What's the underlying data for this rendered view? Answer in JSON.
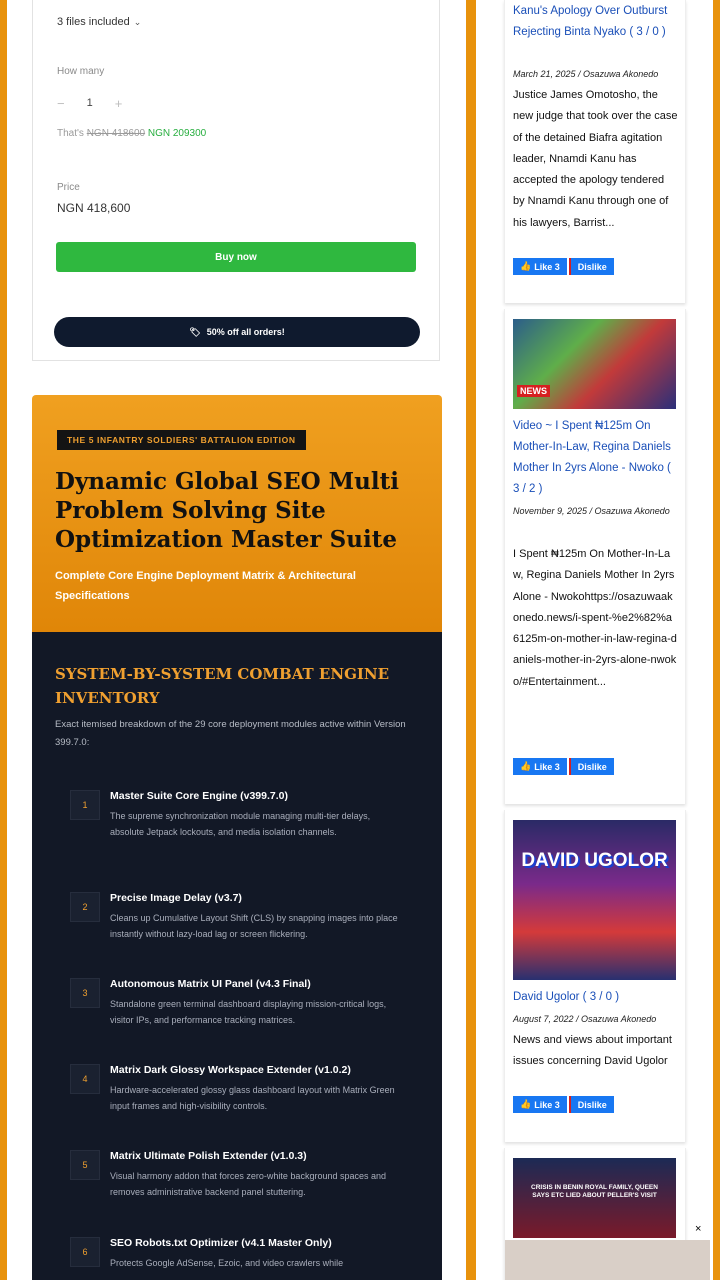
{
  "product_card": {
    "files_included": "3 files included",
    "how_many_label": "How many",
    "quantity": "1",
    "minus": "−",
    "plus": "+",
    "thats_prefix": "That's",
    "old_price": "NGN 418600",
    "new_price": "NGN 209300",
    "price_label": "Price",
    "price_value": "NGN 418,600",
    "buy_label": "Buy now",
    "promo_label": "50% off all orders!"
  },
  "hero": {
    "badge": "THE 5 INFANTRY SOLDIERS' BATTALION EDITION",
    "title": "Dynamic Global SEO Multi Problem Solving Site Optimization Master Suite",
    "subtitle": "Complete Core Engine Deployment Matrix & Architectural Specifications"
  },
  "inventory": {
    "title": "SYSTEM-BY-SYSTEM COMBAT ENGINE INVENTORY",
    "description": "Exact itemised breakdown of the 29 core deployment modules active within Version 399.7.0:",
    "modules": [
      {
        "num": "1",
        "title": "Master Suite Core Engine (v399.7.0)",
        "desc": "The supreme synchronization module managing multi-tier delays, absolute Jetpack lockouts, and media isolation channels."
      },
      {
        "num": "2",
        "title": "Precise Image Delay (v3.7)",
        "desc": "Cleans up Cumulative Layout Shift (CLS) by snapping images into place instantly without lazy-load lag or screen flickering."
      },
      {
        "num": "3",
        "title": "Autonomous Matrix UI Panel (v4.3 Final)",
        "desc": "Standalone green terminal dashboard displaying mission-critical logs, visitor IPs, and performance tracking matrices."
      },
      {
        "num": "4",
        "title": "Matrix Dark Glossy Workspace Extender (v1.0.2)",
        "desc": "Hardware-accelerated glossy glass dashboard layout with Matrix Green input frames and high-visibility controls."
      },
      {
        "num": "5",
        "title": "Matrix Ultimate Polish Extender (v1.0.3)",
        "desc": "Visual harmony addon that forces zero-white background spaces and removes administrative backend panel stuttering."
      },
      {
        "num": "6",
        "title": "SEO Robots.txt Optimizer (v4.1 Master Only)",
        "desc": "Protects Google AdSense, Ezoic, and video crawlers while"
      }
    ]
  },
  "sidebar": {
    "posts": [
      {
        "title": "Kanu's Apology Over Outburst Rejecting Binta Nyako ( 3 / 0 )",
        "meta": "March 21, 2025 / Osazuwa Akonedo",
        "excerpt": "Justice James Omotosho, the new judge that took over the case of the detained Biafra agitation leader, Nnamdi Kanu has accepted the apology tendered by Nnamdi Kanu through one of his lawyers, Barrist...",
        "like": "Like 3",
        "dislike": "Dislike"
      },
      {
        "thumb_text": "NEWS",
        "title": "Video ~ I Spent ₦125m On Mother-In-Law, Regina Daniels Mother In 2yrs Alone - Nwoko ( 3 / 2 )",
        "meta": "November 9, 2025 / Osazuwa Akonedo",
        "excerpt": "I Spent ₦125m On Mother-In-Law, Regina Daniels Mother In 2yrs Alone - Nwokohttps://osazuwaakonedo.news/i-spent-%e2%82%a6125m-on-mother-in-law-regina-daniels-mother-in-2yrs-alone-nwoko/#Entertainment...",
        "like": "Like 3",
        "dislike": "Dislike"
      },
      {
        "thumb_text": "DAVID UGOLOR",
        "title": "David Ugolor ( 3 / 0 )",
        "meta": "August 7, 2022 / Osazuwa Akonedo",
        "excerpt": "News and views about important issues concerning David Ugolor",
        "like": "Like 3",
        "dislike": "Dislike"
      },
      {
        "thumb_text": "CRISIS IN BENIN ROYAL FAMILY, QUEEN SAYS ETC LIED ABOUT PELLER'S VISIT"
      }
    ]
  },
  "overlay": {
    "close": "×"
  }
}
